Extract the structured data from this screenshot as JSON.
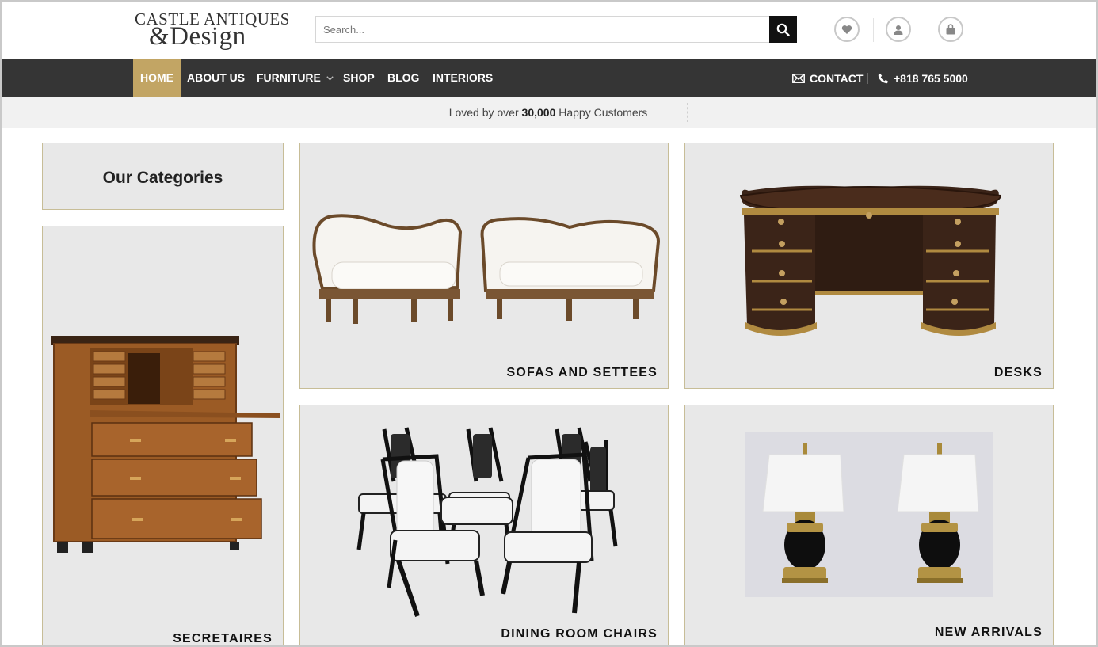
{
  "logo": {
    "line1": "Castle Antiques",
    "line2": "&Design"
  },
  "search": {
    "placeholder": "Search..."
  },
  "header_icons": [
    "heart-icon",
    "user-icon",
    "shopping-bag-icon"
  ],
  "nav": {
    "items": [
      {
        "label": "HOME",
        "active": true
      },
      {
        "label": "ABOUT US"
      },
      {
        "label": "FURNITURE",
        "has_dropdown": true
      },
      {
        "label": "SHOP"
      },
      {
        "label": "BLOG"
      },
      {
        "label": "INTERIORS"
      }
    ],
    "contact_label": "CONTACT",
    "phone": "+818 765 5000"
  },
  "promo": {
    "prefix": "Loved by over",
    "count": "30,000",
    "suffix": "Happy Customers"
  },
  "categories": {
    "heading": "Our Categories",
    "tiles": [
      {
        "label": "SECRETAIRES"
      },
      {
        "label": "SOFAS AND SETTEES"
      },
      {
        "label": "DESKS"
      },
      {
        "label": "DINING ROOM CHAIRS"
      },
      {
        "label": "NEW ARRIVALS"
      }
    ]
  },
  "colors": {
    "nav_bg": "#353535",
    "accent": "#c2a564",
    "tile_bg": "#e8e8e8",
    "tile_border": "#c7bd97"
  }
}
